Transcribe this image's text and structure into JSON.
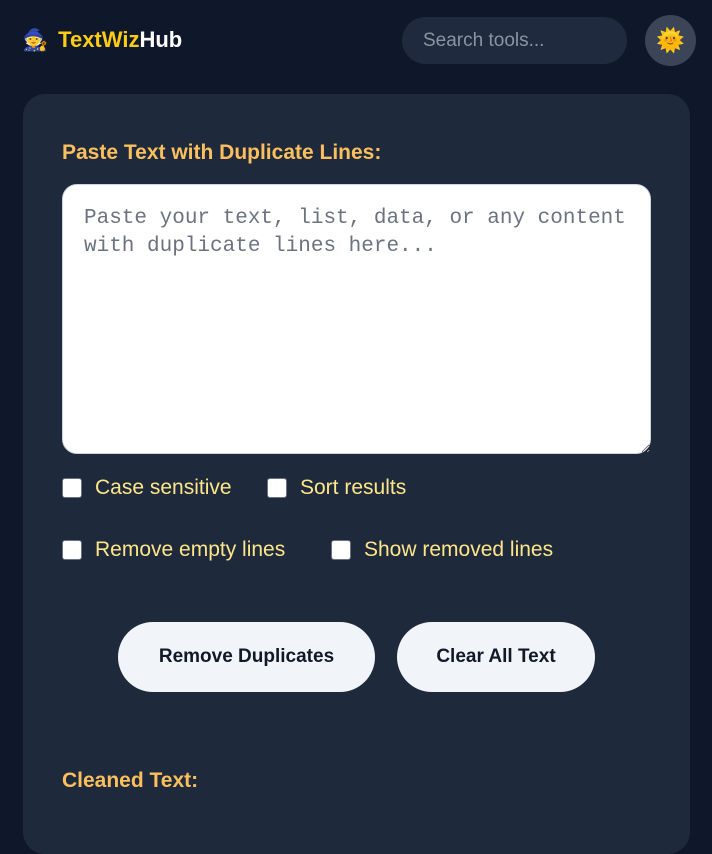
{
  "header": {
    "logo_icon": "🧙",
    "logo_part1": "TextWiz",
    "logo_part2": "Hub",
    "search_placeholder": "Search tools...",
    "theme_icon": "sun-icon",
    "theme_glyph": "🌞"
  },
  "tool": {
    "input_label": "Paste Text with Duplicate Lines:",
    "input_placeholder": "Paste your text, list, data, or any content with duplicate lines here...",
    "options": {
      "case_sensitive": "Case sensitive",
      "sort_results": "Sort results",
      "remove_empty": "Remove empty lines",
      "show_removed": "Show removed lines"
    },
    "buttons": {
      "remove": "Remove Duplicates",
      "clear": "Clear All Text"
    },
    "output_label": "Cleaned Text:"
  },
  "colors": {
    "background": "#0f172a",
    "card": "#1e293b",
    "accent": "#facc15",
    "label": "#fbbf5e"
  }
}
